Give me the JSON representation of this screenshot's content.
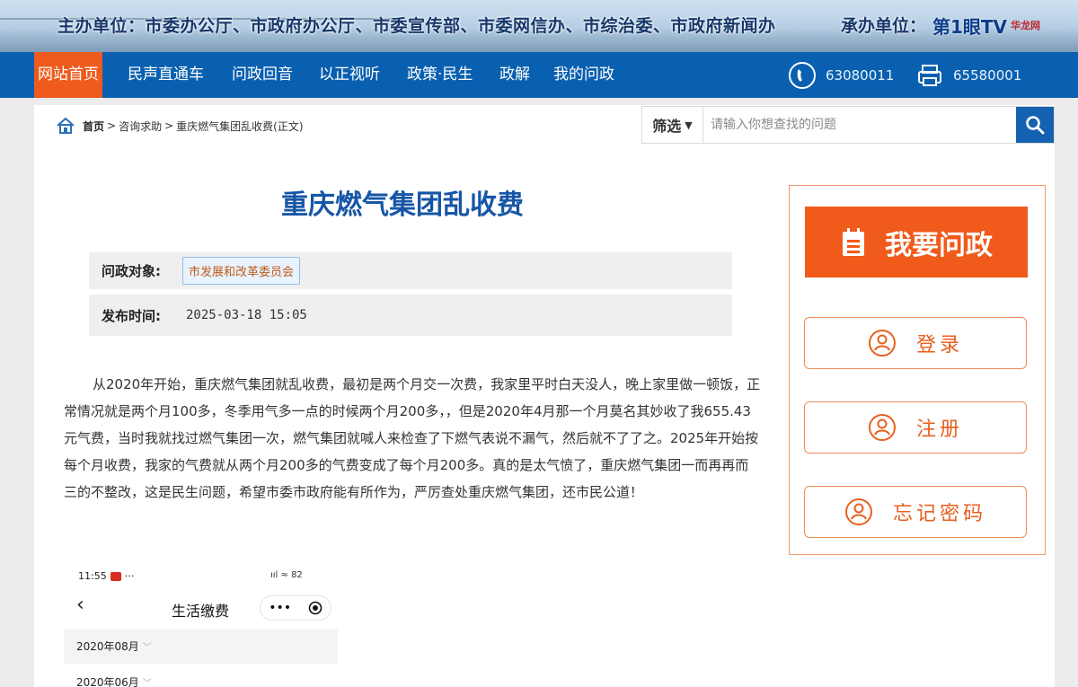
{
  "banner": {
    "host_label": "主办单位：市委办公厅、市政府办公厅、市委宣传部、市委网信办、市综治委、市政府新闻办",
    "organizer_label": "承办单位：",
    "tv_logo": "第1眼TV",
    "tv_logo_sub": "华龙网"
  },
  "nav": {
    "items": [
      {
        "label": "网站首页",
        "active": true
      },
      {
        "label": "民声直通车"
      },
      {
        "label": "问政回音"
      },
      {
        "label": "以正视听"
      },
      {
        "label": "政策·民生"
      },
      {
        "label": "政解"
      },
      {
        "label": "我的问政"
      }
    ],
    "phone_number": "63080011",
    "fax_number": "65580001",
    "icons": [
      "phone-icon",
      "fax-icon"
    ]
  },
  "breadcrumb": {
    "home": "首页",
    "sep1": ">",
    "level1": "咨询求助",
    "sep2": ">",
    "current": "重庆燃气集团乱收费(正文)"
  },
  "search": {
    "filter_label": "筛选",
    "filter_arrow": "▼",
    "placeholder": "请输入你想查找的问题"
  },
  "article": {
    "title": "重庆燃气集团乱收费",
    "target_label": "问政对象:",
    "target_value": "市发展和改革委员会",
    "time_label": "发布时间:",
    "time_value": "2025-03-18 15:05",
    "body": "从2020年开始，重庆燃气集团就乱收费，最初是两个月交一次费，我家里平时白天没人，晚上家里做一顿饭，正常情况就是两个月100多，冬季用气多一点的时候两个月200多，，但是2020年4月那一个月莫名其妙收了我655.43元气费，当时我就找过燃气集团一次，燃气集团就喊人来检查了下燃气表说不漏气，然后就不了了之。2025年开始按每个月收费，我家的气费就从两个月200多的气费变成了每个月200多。真的是太气愤了，重庆燃气集团一而再再而三的不整改，这是民生问题，希望市委市政府能有所作为，严厉查处重庆燃气集团，还市民公道！"
  },
  "screenshot": {
    "time": "11:55",
    "extra": "···",
    "status_icons": "ııl ≈ 82",
    "back": "‹",
    "title": "生活缴费",
    "capsule_dots": "•••",
    "months": [
      "2020年08月",
      "2020年06月"
    ]
  },
  "sidebar": {
    "ask_label": "我要问政",
    "login_label": "登录",
    "register_label": "注册",
    "forgot_label": "忘记密码"
  },
  "colors": {
    "nav_bg": "#0a60b0",
    "active_tab": "#ee5b1d",
    "title": "#1756a6",
    "accent_orange": "#f05a1a"
  }
}
